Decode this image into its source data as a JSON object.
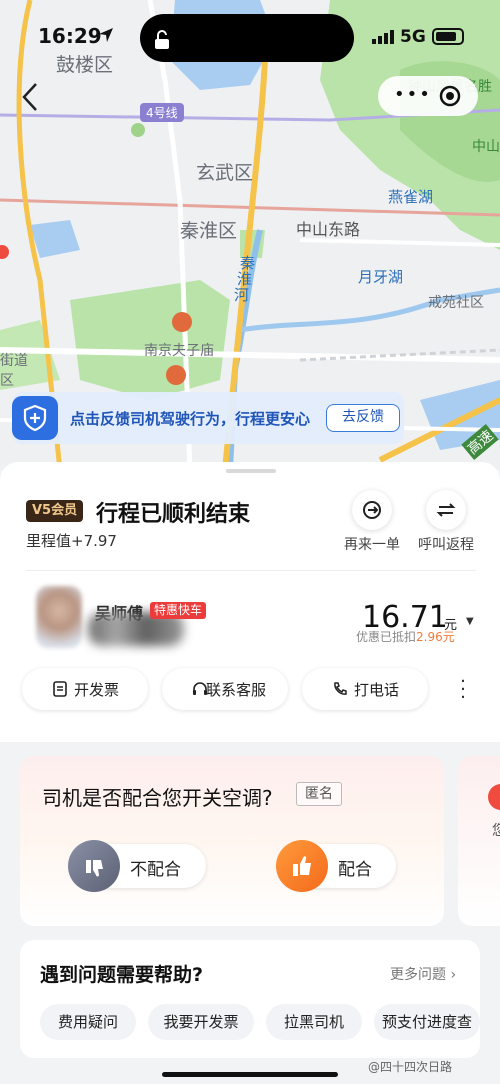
{
  "status_bar": {
    "time": "16:29",
    "network": "5G"
  },
  "map": {
    "labels": {
      "gulou": "鼓楼区",
      "xuanwu": "玄武区",
      "qinhuai": "秦淮区",
      "zhongshan_east": "中山东路",
      "qinhuai_river_1": "秦",
      "qinhuai_river_2": "淮",
      "qinhuai_river_3": "河",
      "yanque_lake": "燕雀湖",
      "yueya_lake": "月牙湖",
      "qiyuan": "戒苑社区",
      "fuzimiao": "南京夫子庙",
      "zhongshan_scenic": "钟山风景名胜",
      "zhong": "中山",
      "jiedao": "街道",
      "qu": "区",
      "gaosu": "高速",
      "route_badge": "4号线"
    }
  },
  "banner": {
    "text": "点击反馈司机驾驶行为，行程更安心",
    "button": "去反馈"
  },
  "trip": {
    "vip_badge": "V5会员",
    "title": "行程已顺利结束",
    "mileage": "里程值+7.97",
    "reorder_label": "再来一单",
    "return_label": "呼叫返程"
  },
  "driver": {
    "name": "吴师傅",
    "car_type": "特惠快车"
  },
  "fare": {
    "amount": "16.71",
    "unit": "元",
    "discount_prefix": "优惠已抵扣",
    "discount_value": "2.96元"
  },
  "actions": {
    "invoice": "开发票",
    "service": "联系客服",
    "call": "打电话"
  },
  "survey": {
    "question": "司机是否配合您开关空调?",
    "anonymous": "匿名",
    "option_no": "不配合",
    "option_yes": "配合",
    "peek_char": "您"
  },
  "help": {
    "title": "遇到问题需要帮助?",
    "more": "更多问题 ›",
    "tags": [
      "费用疑问",
      "我要开发票",
      "拉黑司机",
      "预支付进度查"
    ]
  },
  "watermark": "@四十四次日路",
  "colors": {
    "accent_blue": "#2d6fe0",
    "tag_red": "#ec3b3b",
    "vip_gold": "#f1c88e",
    "discount_orange": "#f27a3a",
    "thumb_orange": "#f77b24"
  }
}
